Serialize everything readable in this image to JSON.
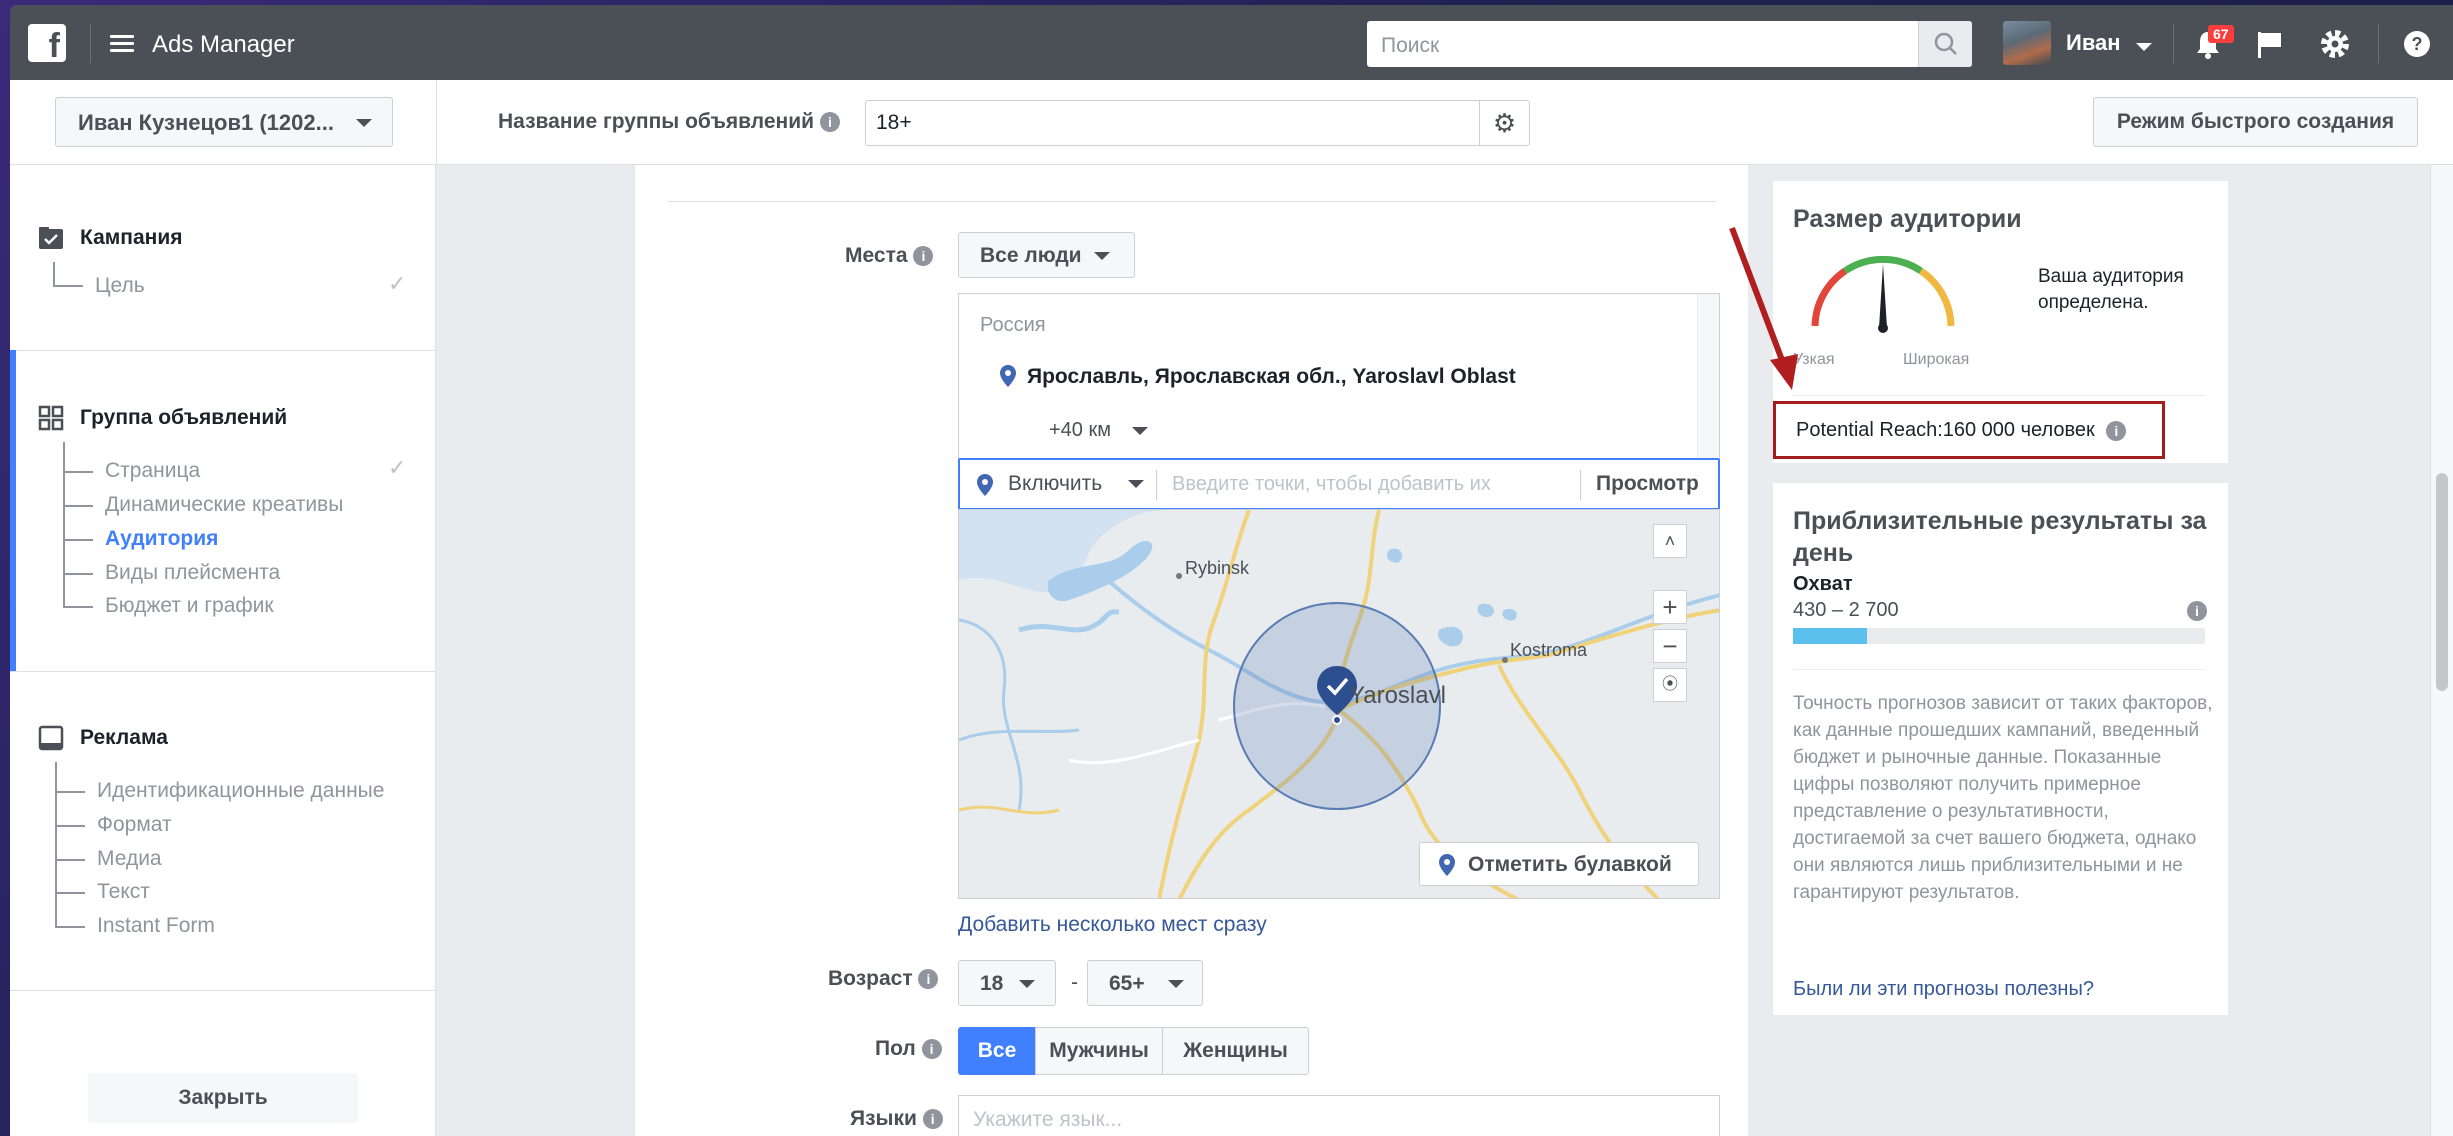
{
  "topbar": {
    "logo": "f",
    "app_title": "Ads Manager",
    "search_placeholder": "Поиск",
    "user_name": "Иван",
    "notification_count": "67"
  },
  "subbar": {
    "account": "Иван Кузнецов1 (1202...",
    "adset_label": "Название группы объявлений",
    "adset_value": "18+",
    "quick_mode": "Режим быстрого создания"
  },
  "sidebar": {
    "campaign": {
      "title": "Кампания",
      "items": [
        "Цель"
      ]
    },
    "adset": {
      "title": "Группа объявлений",
      "items": [
        "Страница",
        "Динамические креативы",
        "Аудитория",
        "Виды плейсмента",
        "Бюджет и график"
      ]
    },
    "ad": {
      "title": "Реклама",
      "items": [
        "Идентификационные данные",
        "Формат",
        "Медиа",
        "Текст",
        "Instant Form"
      ]
    },
    "close": "Закрыть"
  },
  "main": {
    "places_label": "Места",
    "people_select": "Все люди",
    "country": "Россия",
    "location": "Ярославль, Ярославская обл., Yaroslavl Oblast",
    "radius": "+40 км",
    "include": "Включить",
    "points_placeholder": "Введите точки, чтобы добавить их",
    "view": "Просмотр",
    "map_labels": {
      "rybinsk": "Rybinsk",
      "kostroma": "Kostroma",
      "yaroslavl": "Yaroslavl"
    },
    "pin_button": "Отметить булавкой",
    "add_many": "Добавить несколько мест сразу",
    "age_label": "Возраст",
    "age_min": "18",
    "age_dash": "-",
    "age_max": "65+",
    "gender_label": "Пол",
    "gender_all": "Все",
    "gender_men": "Мужчины",
    "gender_women": "Женщины",
    "languages_label": "Языки",
    "languages_placeholder": "Укажите язык..."
  },
  "audience": {
    "title": "Размер аудитории",
    "status": "Ваша аудитория определена.",
    "narrow": "Узкая",
    "wide": "Широкая",
    "potential_reach": "Potential Reach:160 000 человек"
  },
  "results": {
    "title": "Приблизительные результаты за день",
    "reach_label": "Охват",
    "reach_range": "430 – 2 700",
    "reach_fill_fraction": 0.18,
    "disclaimer": "Точность прогнозов зависит от таких факторов, как данные прошедших кампаний, введенный бюджет и рыночные данные. Показанные цифры позволяют получить примерное представление о результативности, достигаемой за счет вашего бюджета, однако они являются лишь приблизительными и не гарантируют результатов.",
    "feedback": "Были ли эти прогнозы полезны?"
  },
  "colors": {
    "topbar": "#4b4f56",
    "accent": "#4080ff",
    "highlight_box": "#a31d1d",
    "arrow": "#b01e1e"
  }
}
